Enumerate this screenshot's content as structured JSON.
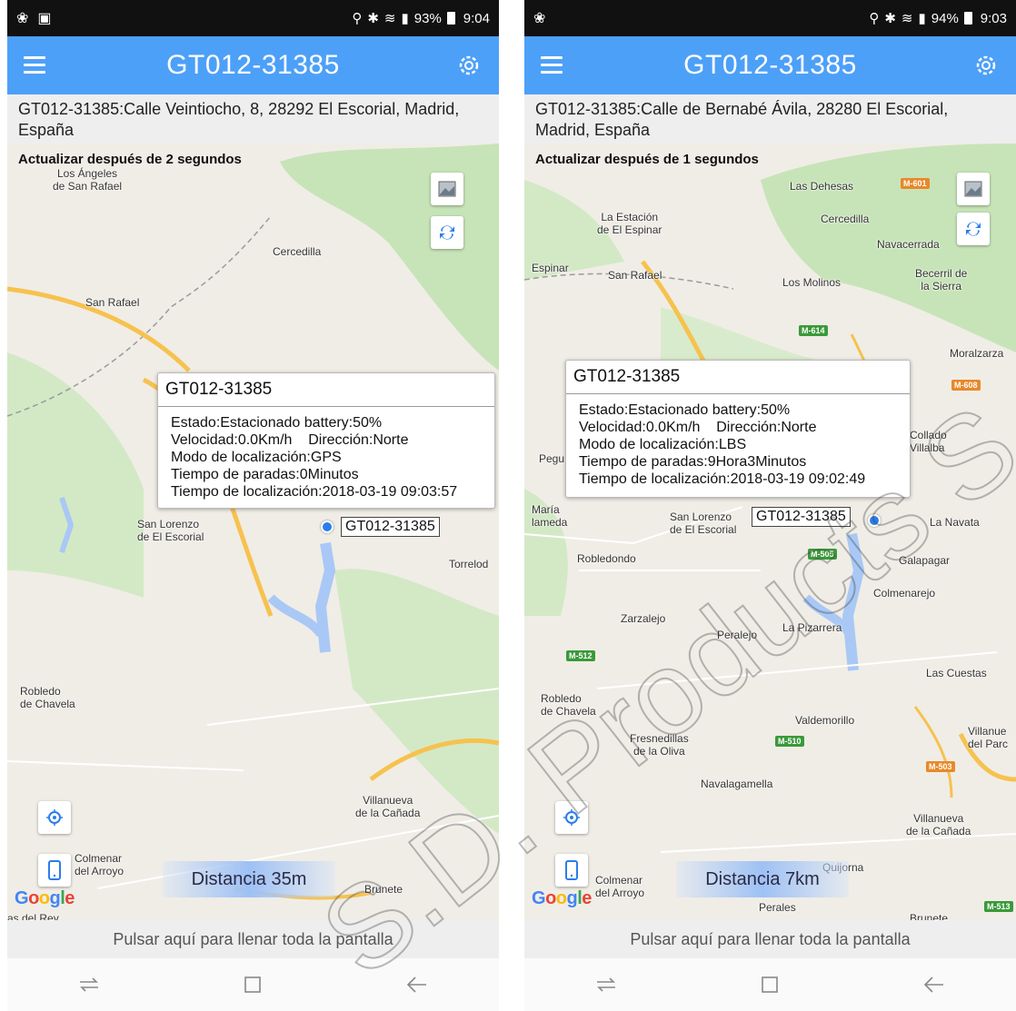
{
  "colors": {
    "appbar": "#4da0f8",
    "marker": "#2b7de9",
    "water": "#a9c8f5",
    "forest": "#c7e4b8",
    "road": "#f6c24f"
  },
  "left": {
    "status": {
      "battery": "93%",
      "time": "9:04"
    },
    "app_title": "GT012-31385",
    "address": "GT012-31385:Calle Veintiocho, 8, 28292 El Escorial, Madrid, España",
    "refresh": "Actualizar después de 2 segundos",
    "info": {
      "title": "GT012-31385",
      "estado": "Estado:Estacionado battery:50%",
      "velocidad": "Velocidad:0.0Km/h",
      "direccion": "Dirección:Norte",
      "modo": "Modo de localización:GPS",
      "paradas": "Tiempo de paradas:0Minutos",
      "localizacion": "Tiempo de localización:2018-03-19 09:03:57"
    },
    "marker_label": "GT012-31385",
    "distance": "Distancia 35m",
    "places": [
      "Los Ángeles\nde San Rafael",
      "Cercedilla",
      "San Rafael",
      "San Lorenzo\nde El Escorial",
      "Torrelod",
      "Robledo\nde Chavela",
      "Villanueva\nde la Cañada",
      "Colmenar\ndel Arroyo",
      "Brunete",
      "as del Rey"
    ]
  },
  "right": {
    "status": {
      "battery": "94%",
      "time": "9:03"
    },
    "app_title": "GT012-31385",
    "address": "GT012-31385:Calle de Bernabé Ávila, 28280 El Escorial, Madrid, España",
    "refresh": "Actualizar después de 1 segundos",
    "info": {
      "title": "GT012-31385",
      "estado": "Estado:Estacionado battery:50%",
      "velocidad": "Velocidad:0.0Km/h",
      "direccion": "Dirección:Norte",
      "modo": "Modo de localización:LBS",
      "paradas": "Tiempo de paradas:9Hora3Minutos",
      "localizacion": "Tiempo de localización:2018-03-19 09:02:49"
    },
    "marker_label": "GT012-31385",
    "distance": "Distancia 7km",
    "places": [
      "Las Dehesas",
      "Cercedilla",
      "La Estación\nde El Espinar",
      "Navacerrada",
      "Espinar",
      "San Rafael",
      "Los Molinos",
      "Becerril de\nla Sierra",
      "Moralzarza",
      "Collado\nVillalba",
      "Pegu",
      "María\nlameda",
      "San Lorenzo\nde El Escorial",
      "La Navata",
      "Robledondo",
      "Galapagar",
      "Colmenarejo",
      "Zarzalejo",
      "Peralejo",
      "La Pizarrera",
      "Las Cuestas",
      "Robledo\nde Chavela",
      "Valdemorillo",
      "Villanue\ndel Parc",
      "Fresnedillas\nde la Oliva",
      "Navalagamella",
      "Villanueva\nde la Cañada",
      "Quijorna",
      "Colmenar\ndel Arroyo",
      "Perales",
      "Brunete"
    ],
    "roads": [
      "M-601",
      "M-614",
      "M-608",
      "M-505",
      "M-512",
      "M-510",
      "M-503",
      "M-513"
    ]
  },
  "bottom_text": "Pulsar aquí para llenar toda la pantalla",
  "google": [
    "G",
    "o",
    "o",
    "g",
    "l",
    "e"
  ],
  "watermark": "S.D. Products S.A."
}
